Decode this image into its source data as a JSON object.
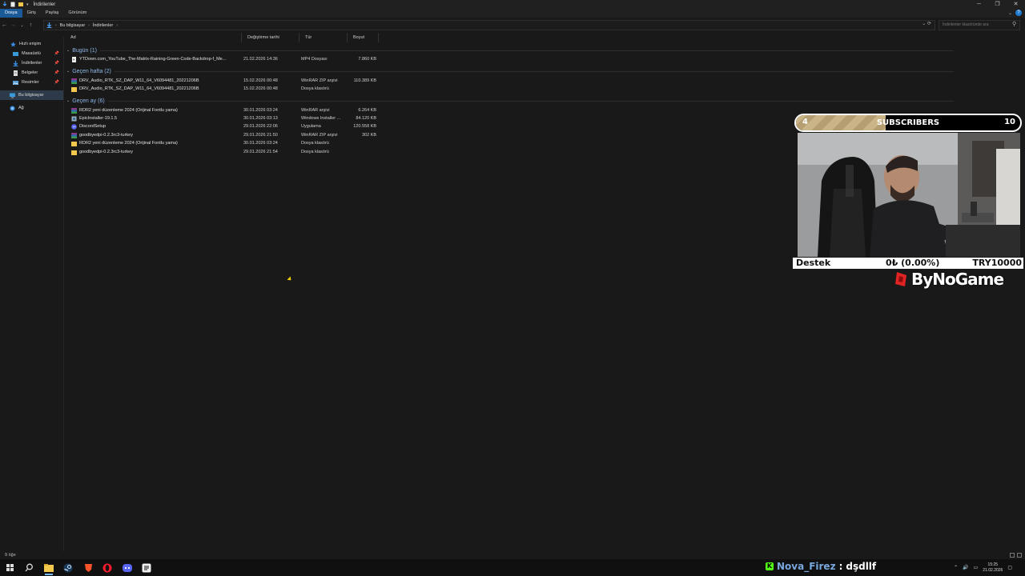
{
  "window": {
    "title": "İndirilenler",
    "controls": [
      "─",
      "❐",
      "✕"
    ]
  },
  "ribbon": {
    "tabs": [
      "Dosya",
      "Giriş",
      "Paylaş",
      "Görünüm"
    ]
  },
  "address": {
    "crumbs": [
      "Bu bilgisayar",
      "İndirilenler"
    ],
    "search_placeholder": "İndirilenler klasöründe ara"
  },
  "sidebar": {
    "items": [
      {
        "label": "Hızlı erişim",
        "icon": "star-icon",
        "pinned": false
      },
      {
        "label": "Masaüstü",
        "icon": "desktop-icon",
        "pinned": true
      },
      {
        "label": "İndirilenler",
        "icon": "download-icon",
        "pinned": true
      },
      {
        "label": "Belgeler",
        "icon": "document-icon",
        "pinned": true
      },
      {
        "label": "Resimler",
        "icon": "pictures-icon",
        "pinned": true
      },
      {
        "label": "Bu bilgisayar",
        "icon": "computer-icon",
        "pinned": false
      },
      {
        "label": "Ağ",
        "icon": "network-icon",
        "pinned": false
      }
    ]
  },
  "columns": [
    "Ad",
    "Değiştirme tarihi",
    "Tür",
    "Boyut"
  ],
  "groups": [
    {
      "title": "Bugün (1)",
      "files": [
        {
          "name": "YTDown.com_YouTube_The-Matrix-Raining-Green-Code-Backdrop-f_Me...",
          "date": "21.02.2026 14:36",
          "type": "MP4 Dosyası",
          "size": "7.860 KB",
          "icon": "video"
        }
      ]
    },
    {
      "title": "Geçen hafta (2)",
      "files": [
        {
          "name": "DRV_Audio_RTK_SZ_DAP_W11_64_V6094481_20221206B",
          "date": "15.02.2026 00:48",
          "type": "WinRAR ZIP arşivi",
          "size": "110.389 KB",
          "icon": "zip"
        },
        {
          "name": "DRV_Audio_RTK_SZ_DAP_W11_64_V6094481_20221206B",
          "date": "15.02.2026 00:48",
          "type": "Dosya klasörü",
          "size": "",
          "icon": "folder"
        }
      ]
    },
    {
      "title": "Geçen ay (6)",
      "files": [
        {
          "name": "RDR2 yeni düzenleme 2024 (Orijinal Fontlu yama)",
          "date": "30.01.2026 03:24",
          "type": "WinRAR arşivi",
          "size": "6.264 KB",
          "icon": "rar"
        },
        {
          "name": "EpicInstaller-19.1.5",
          "date": "30.01.2026 03:13",
          "type": "Windows Installer ...",
          "size": "84.120 KB",
          "icon": "installer"
        },
        {
          "name": "DiscordSetup",
          "date": "29.01.2026 22:06",
          "type": "Uygulama",
          "size": "120.558 KB",
          "icon": "discord"
        },
        {
          "name": "goodbyedpi-0.2.3rc3-turkey",
          "date": "29.01.2026 21:50",
          "type": "WinRAR ZIP arşivi",
          "size": "302 KB",
          "icon": "zip"
        },
        {
          "name": "RDR2 yeni düzenleme 2024 (Orijinal Fontlu yama)",
          "date": "30.01.2026 03:24",
          "type": "Dosya klasörü",
          "size": "",
          "icon": "folder"
        },
        {
          "name": "goodbyedpi-0.2.3rc3-turkey",
          "date": "29.01.2026 21:54",
          "type": "Dosya klasörü",
          "size": "",
          "icon": "folder"
        }
      ]
    }
  ],
  "status": {
    "count": "9 öğe"
  },
  "taskbar": {
    "time": "15:25",
    "date": "21.02.2026"
  },
  "overlay": {
    "sub_current": "4",
    "sub_label": "SUBSCRIBERS",
    "sub_goal": "10",
    "donation_label": "Destek",
    "donation_amount": "0₺ (0.00%)",
    "donation_goal": "TRY10000",
    "brand": "ByNoGame"
  },
  "chat": {
    "user": "Nova_Firez",
    "separator": ":",
    "message": "dşdllf"
  },
  "colors": {
    "accent": "#1b5a99",
    "group_header": "#8fb8e8",
    "chat_user": "#78a7dc",
    "kick_green": "#53fc18"
  }
}
